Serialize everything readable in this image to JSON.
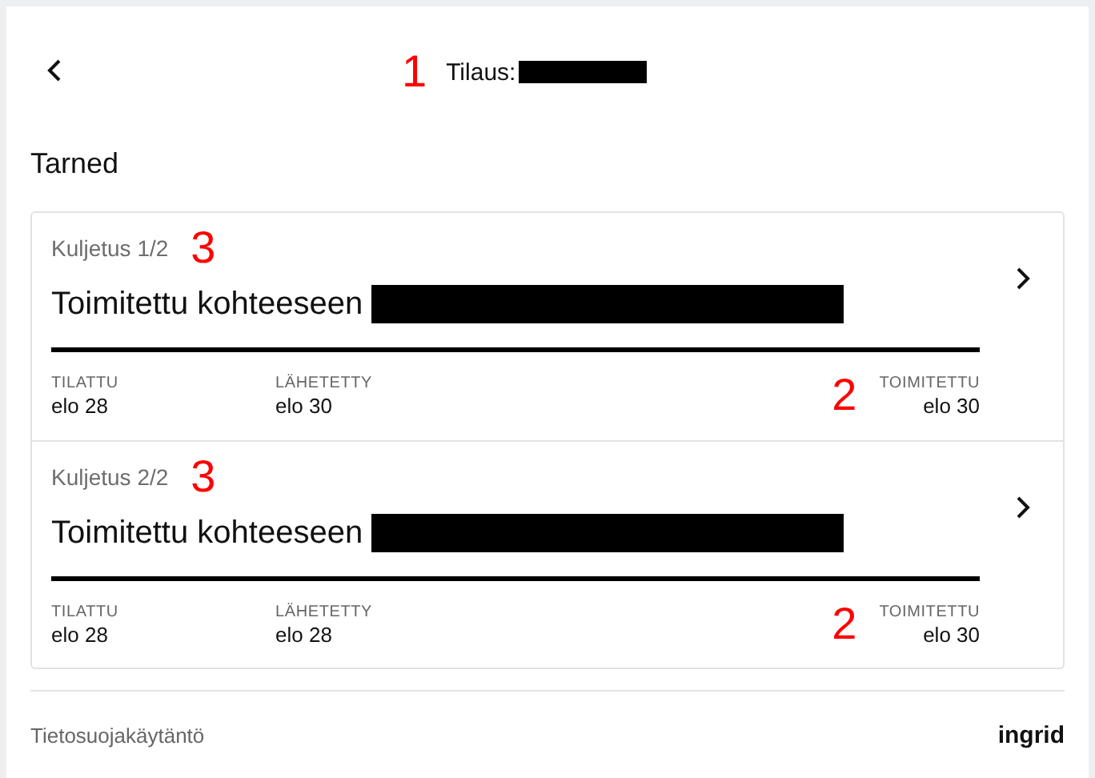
{
  "header": {
    "title": "Tilaus:",
    "annotation": "1"
  },
  "section_title": "Tarned",
  "shipments": [
    {
      "label": "Kuljetus 1/2",
      "annotation": "3",
      "status": "Toimitettu kohteeseen",
      "progress": {
        "level": 1
      },
      "steps": [
        {
          "label": "TILATTU",
          "date": "elo 28"
        },
        {
          "label": "LÄHETETTY",
          "date": "elo 30"
        },
        {
          "label": "TOIMITETTU",
          "date": "elo 30"
        }
      ],
      "steps_annotation": "2"
    },
    {
      "label": "Kuljetus 2/2",
      "annotation": "3",
      "status": "Toimitettu kohteeseen",
      "progress": {
        "level": 1
      },
      "steps": [
        {
          "label": "TILATTU",
          "date": "elo 28"
        },
        {
          "label": "LÄHETETTY",
          "date": "elo 28"
        },
        {
          "label": "TOIMITETTU",
          "date": "elo 30"
        }
      ],
      "steps_annotation": "2"
    }
  ],
  "footer": {
    "link": "Tietosuojakäytäntö",
    "logo": "ingrid"
  }
}
